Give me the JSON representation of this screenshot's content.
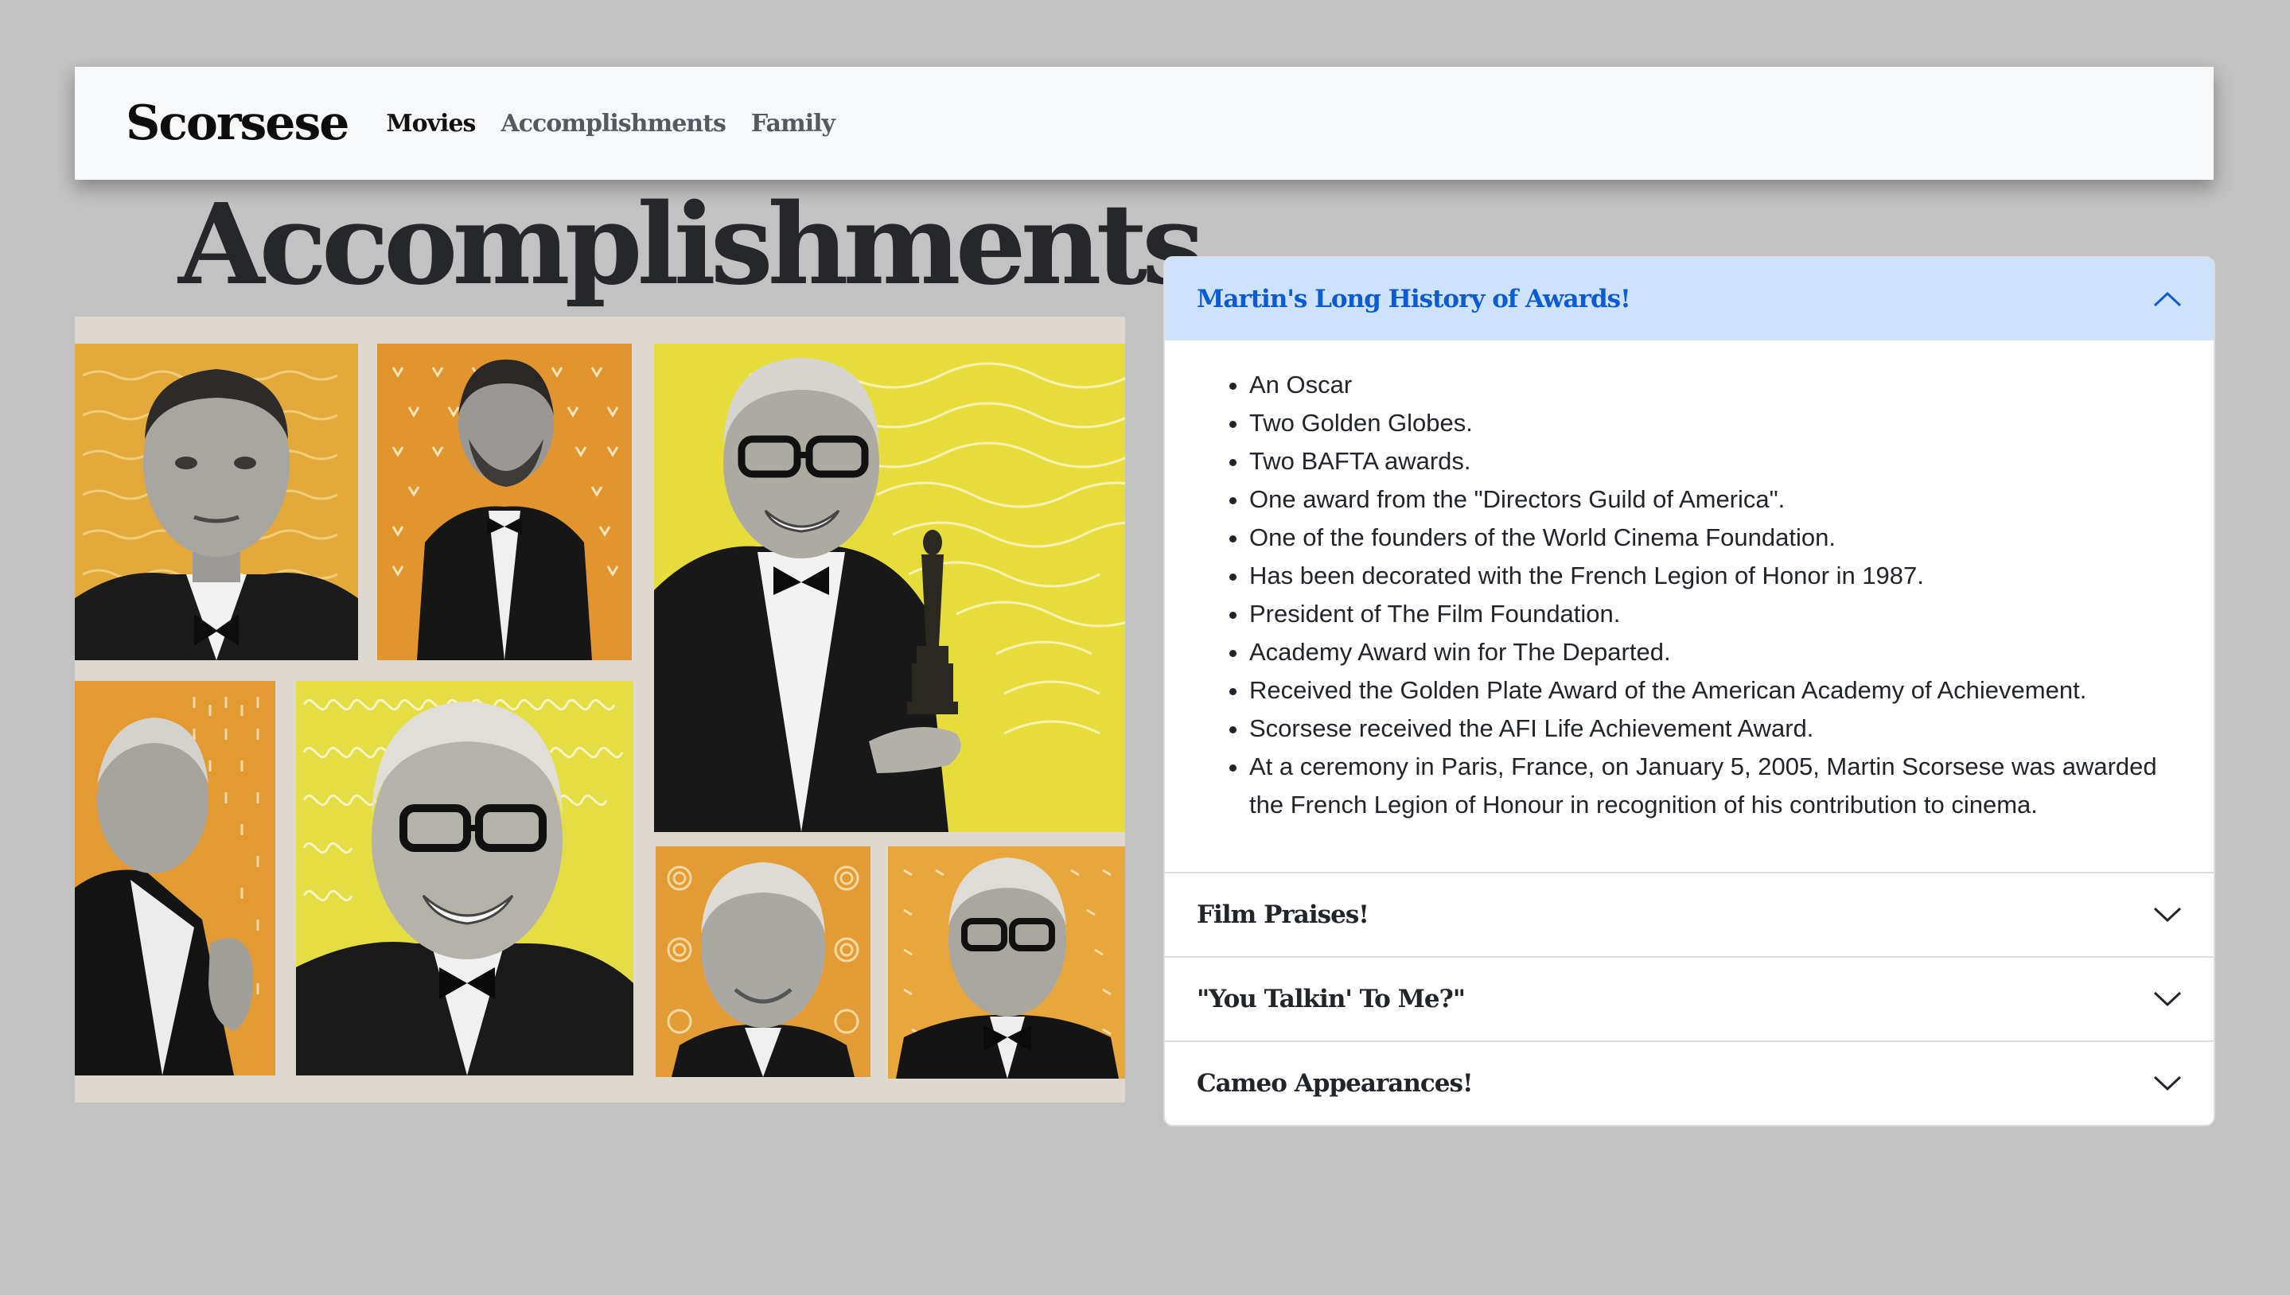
{
  "nav": {
    "brand": "Scorsese",
    "links": [
      "Movies",
      "Accomplishments",
      "Family"
    ]
  },
  "page_title": "Accomplishments",
  "accordion": [
    {
      "title": "Martin's Long History of Awards!",
      "expanded": true,
      "items": [
        "An Oscar",
        "Two Golden Globes.",
        "Two BAFTA awards.",
        "One award from the \"Directors Guild of America\".",
        "One of the founders of the World Cinema Foundation.",
        "Has been decorated with the French Legion of Honor in 1987.",
        "President of The Film Foundation.",
        "Academy Award win for The Departed.",
        "Received the Golden Plate Award of the American Academy of Achievement.",
        "Scorsese received the AFI Life Achievement Award.",
        "At a ceremony in Paris, France, on January 5, 2005, Martin Scorsese was awarded the French Legion of Honour in recognition of his contribution to cinema."
      ]
    },
    {
      "title": "Film Praises!",
      "expanded": false
    },
    {
      "title": "\"You Talkin' To Me?\"",
      "expanded": false
    },
    {
      "title": "Cameo Appearances!",
      "expanded": false
    }
  ],
  "colors": {
    "background": "#c2c2c2",
    "navbar": "#f7f8fa",
    "accent": "#0b5bd3",
    "accordion_open_bg": "#cfe2fb",
    "collage_orange": "#e39a35",
    "collage_yellow": "#e2dc3a"
  },
  "icons": {
    "accordion_open": "chevron-up-icon",
    "accordion_closed": "chevron-down-icon"
  }
}
